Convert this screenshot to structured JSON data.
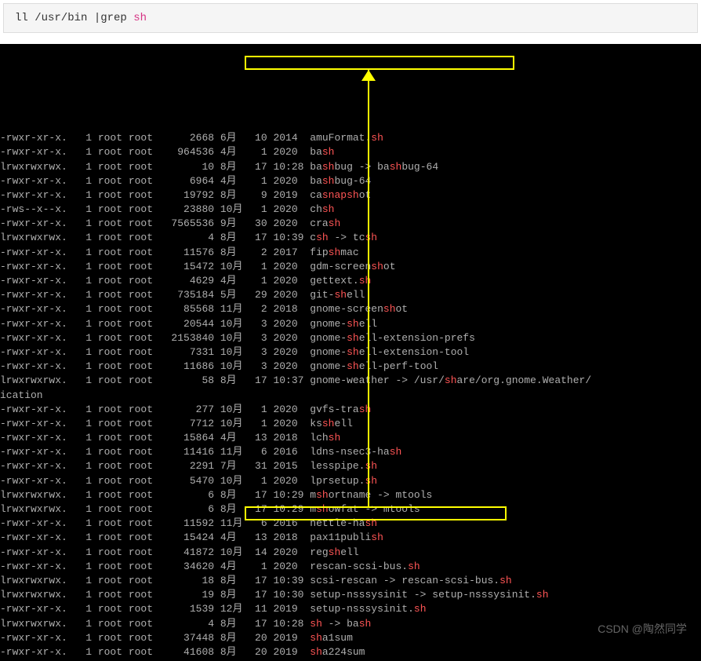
{
  "command": {
    "prefix": "ll /usr/bin |grep ",
    "highlight": "sh"
  },
  "watermark": "CSDN @陶然同学",
  "rows": [
    {
      "perm": "-rwxr-xr-x.",
      "n": "1",
      "u": "root",
      "g": "root",
      "sz": "2668",
      "m": "6月",
      "d": "10",
      "t": "2014",
      "pre": "amuFormat.",
      "hl": "sh",
      "post": ""
    },
    {
      "perm": "-rwxr-xr-x.",
      "n": "1",
      "u": "root",
      "g": "root",
      "sz": "964536",
      "m": "4月",
      "d": "1",
      "t": "2020",
      "pre": "ba",
      "hl": "sh",
      "post": ""
    },
    {
      "perm": "lrwxrwxrwx.",
      "n": "1",
      "u": "root",
      "g": "root",
      "sz": "10",
      "m": "8月",
      "d": "17",
      "t": "10:28",
      "pre": "ba",
      "hl": "sh",
      "post": "bug -> ba",
      "hl2": "sh",
      "post2": "bug-64"
    },
    {
      "perm": "-rwxr-xr-x.",
      "n": "1",
      "u": "root",
      "g": "root",
      "sz": "6964",
      "m": "4月",
      "d": "1",
      "t": "2020",
      "pre": "ba",
      "hl": "sh",
      "post": "bug-64"
    },
    {
      "perm": "-rwxr-xr-x.",
      "n": "1",
      "u": "root",
      "g": "root",
      "sz": "19792",
      "m": "8月",
      "d": "9",
      "t": "2019",
      "pre": "ca",
      "hl": "snapsh",
      "post": "ot"
    },
    {
      "perm": "-rws--x--x.",
      "n": "1",
      "u": "root",
      "g": "root",
      "sz": "23880",
      "m": "10月",
      "d": "1",
      "t": "2020",
      "pre": "ch",
      "hl": "sh",
      "post": ""
    },
    {
      "perm": "-rwxr-xr-x.",
      "n": "1",
      "u": "root",
      "g": "root",
      "sz": "7565536",
      "m": "9月",
      "d": "30",
      "t": "2020",
      "pre": "cra",
      "hl": "sh",
      "post": ""
    },
    {
      "perm": "lrwxrwxrwx.",
      "n": "1",
      "u": "root",
      "g": "root",
      "sz": "4",
      "m": "8月",
      "d": "17",
      "t": "10:39",
      "pre": "c",
      "hl": "sh",
      "post": " -> tc",
      "hl2": "sh",
      "post2": ""
    },
    {
      "perm": "-rwxr-xr-x.",
      "n": "1",
      "u": "root",
      "g": "root",
      "sz": "11576",
      "m": "8月",
      "d": "2",
      "t": "2017",
      "pre": "fip",
      "hl": "sh",
      "post": "mac"
    },
    {
      "perm": "-rwxr-xr-x.",
      "n": "1",
      "u": "root",
      "g": "root",
      "sz": "15472",
      "m": "10月",
      "d": "1",
      "t": "2020",
      "pre": "gdm-screen",
      "hl": "sh",
      "post": "ot"
    },
    {
      "perm": "-rwxr-xr-x.",
      "n": "1",
      "u": "root",
      "g": "root",
      "sz": "4629",
      "m": "4月",
      "d": "1",
      "t": "2020",
      "pre": "gettext.",
      "hl": "sh",
      "post": ""
    },
    {
      "perm": "-rwxr-xr-x.",
      "n": "1",
      "u": "root",
      "g": "root",
      "sz": "735184",
      "m": "5月",
      "d": "29",
      "t": "2020",
      "pre": "git-",
      "hl": "sh",
      "post": "ell"
    },
    {
      "perm": "-rwxr-xr-x.",
      "n": "1",
      "u": "root",
      "g": "root",
      "sz": "85568",
      "m": "11月",
      "d": "2",
      "t": "2018",
      "pre": "gnome-screen",
      "hl": "sh",
      "post": "ot"
    },
    {
      "perm": "-rwxr-xr-x.",
      "n": "1",
      "u": "root",
      "g": "root",
      "sz": "20544",
      "m": "10月",
      "d": "3",
      "t": "2020",
      "pre": "gnome-",
      "hl": "sh",
      "post": "ell"
    },
    {
      "perm": "-rwxr-xr-x.",
      "n": "1",
      "u": "root",
      "g": "root",
      "sz": "2153840",
      "m": "10月",
      "d": "3",
      "t": "2020",
      "pre": "gnome-",
      "hl": "sh",
      "post": "ell-extension-prefs"
    },
    {
      "perm": "-rwxr-xr-x.",
      "n": "1",
      "u": "root",
      "g": "root",
      "sz": "7331",
      "m": "10月",
      "d": "3",
      "t": "2020",
      "pre": "gnome-",
      "hl": "sh",
      "post": "ell-extension-tool"
    },
    {
      "perm": "-rwxr-xr-x.",
      "n": "1",
      "u": "root",
      "g": "root",
      "sz": "11686",
      "m": "10月",
      "d": "3",
      "t": "2020",
      "pre": "gnome-",
      "hl": "sh",
      "post": "ell-perf-tool"
    },
    {
      "perm": "lrwxrwxrwx.",
      "n": "1",
      "u": "root",
      "g": "root",
      "sz": "58",
      "m": "8月",
      "d": "17",
      "t": "10:37",
      "pre": "gnome-weather -> /usr/",
      "hl": "sh",
      "post": "are/org.gnome.Weather/",
      "wrap": "ication"
    },
    {
      "perm": "-rwxr-xr-x.",
      "n": "1",
      "u": "root",
      "g": "root",
      "sz": "277",
      "m": "10月",
      "d": "1",
      "t": "2020",
      "pre": "gvfs-tra",
      "hl": "sh",
      "post": ""
    },
    {
      "perm": "-rwxr-xr-x.",
      "n": "1",
      "u": "root",
      "g": "root",
      "sz": "7712",
      "m": "10月",
      "d": "1",
      "t": "2020",
      "pre": "ks",
      "hl": "sh",
      "post": "ell"
    },
    {
      "perm": "-rwxr-xr-x.",
      "n": "1",
      "u": "root",
      "g": "root",
      "sz": "15864",
      "m": "4月",
      "d": "13",
      "t": "2018",
      "pre": "lch",
      "hl": "sh",
      "post": ""
    },
    {
      "perm": "-rwxr-xr-x.",
      "n": "1",
      "u": "root",
      "g": "root",
      "sz": "11416",
      "m": "11月",
      "d": "6",
      "t": "2016",
      "pre": "ldns-nsec3-ha",
      "hl": "sh",
      "post": ""
    },
    {
      "perm": "-rwxr-xr-x.",
      "n": "1",
      "u": "root",
      "g": "root",
      "sz": "2291",
      "m": "7月",
      "d": "31",
      "t": "2015",
      "pre": "lesspipe.",
      "hl": "sh",
      "post": ""
    },
    {
      "perm": "-rwxr-xr-x.",
      "n": "1",
      "u": "root",
      "g": "root",
      "sz": "5470",
      "m": "10月",
      "d": "1",
      "t": "2020",
      "pre": "lprsetup.",
      "hl": "sh",
      "post": ""
    },
    {
      "perm": "lrwxrwxrwx.",
      "n": "1",
      "u": "root",
      "g": "root",
      "sz": "6",
      "m": "8月",
      "d": "17",
      "t": "10:29",
      "pre": "m",
      "hl": "sh",
      "post": "ortname -> mtools"
    },
    {
      "perm": "lrwxrwxrwx.",
      "n": "1",
      "u": "root",
      "g": "root",
      "sz": "6",
      "m": "8月",
      "d": "17",
      "t": "10:29",
      "pre": "m",
      "hl": "sh",
      "post": "owfat -> mtools"
    },
    {
      "perm": "-rwxr-xr-x.",
      "n": "1",
      "u": "root",
      "g": "root",
      "sz": "11592",
      "m": "11月",
      "d": "6",
      "t": "2016",
      "pre": "nettle-ha",
      "hl": "sh",
      "post": ""
    },
    {
      "perm": "-rwxr-xr-x.",
      "n": "1",
      "u": "root",
      "g": "root",
      "sz": "15424",
      "m": "4月",
      "d": "13",
      "t": "2018",
      "pre": "pax11publi",
      "hl": "sh",
      "post": ""
    },
    {
      "perm": "-rwxr-xr-x.",
      "n": "1",
      "u": "root",
      "g": "root",
      "sz": "41872",
      "m": "10月",
      "d": "14",
      "t": "2020",
      "pre": "reg",
      "hl": "sh",
      "post": "ell"
    },
    {
      "perm": "-rwxr-xr-x.",
      "n": "1",
      "u": "root",
      "g": "root",
      "sz": "34620",
      "m": "4月",
      "d": "1",
      "t": "2020",
      "pre": "rescan-scsi-bus.",
      "hl": "sh",
      "post": ""
    },
    {
      "perm": "lrwxrwxrwx.",
      "n": "1",
      "u": "root",
      "g": "root",
      "sz": "18",
      "m": "8月",
      "d": "17",
      "t": "10:39",
      "pre": "scsi-rescan -> rescan-scsi-bus.",
      "hl": "sh",
      "post": ""
    },
    {
      "perm": "lrwxrwxrwx.",
      "n": "1",
      "u": "root",
      "g": "root",
      "sz": "19",
      "m": "8月",
      "d": "17",
      "t": "10:30",
      "pre": "setup-nsssysinit -> setup-nsssysinit.",
      "hl": "sh",
      "post": ""
    },
    {
      "perm": "-rwxr-xr-x.",
      "n": "1",
      "u": "root",
      "g": "root",
      "sz": "1539",
      "m": "12月",
      "d": "11",
      "t": "2019",
      "pre": "setup-nsssysinit.",
      "hl": "sh",
      "post": ""
    },
    {
      "perm": "lrwxrwxrwx.",
      "n": "1",
      "u": "root",
      "g": "root",
      "sz": "4",
      "m": "8月",
      "d": "17",
      "t": "10:28",
      "pre": "",
      "hl": "sh",
      "post": " -> ba",
      "hl2": "sh",
      "post2": ""
    },
    {
      "perm": "-rwxr-xr-x.",
      "n": "1",
      "u": "root",
      "g": "root",
      "sz": "37448",
      "m": "8月",
      "d": "20",
      "t": "2019",
      "pre": "",
      "hl": "sh",
      "post": "a1sum"
    },
    {
      "perm": "-rwxr-xr-x.",
      "n": "1",
      "u": "root",
      "g": "root",
      "sz": "41608",
      "m": "8月",
      "d": "20",
      "t": "2019",
      "pre": "",
      "hl": "sh",
      "post": "a224sum"
    }
  ]
}
